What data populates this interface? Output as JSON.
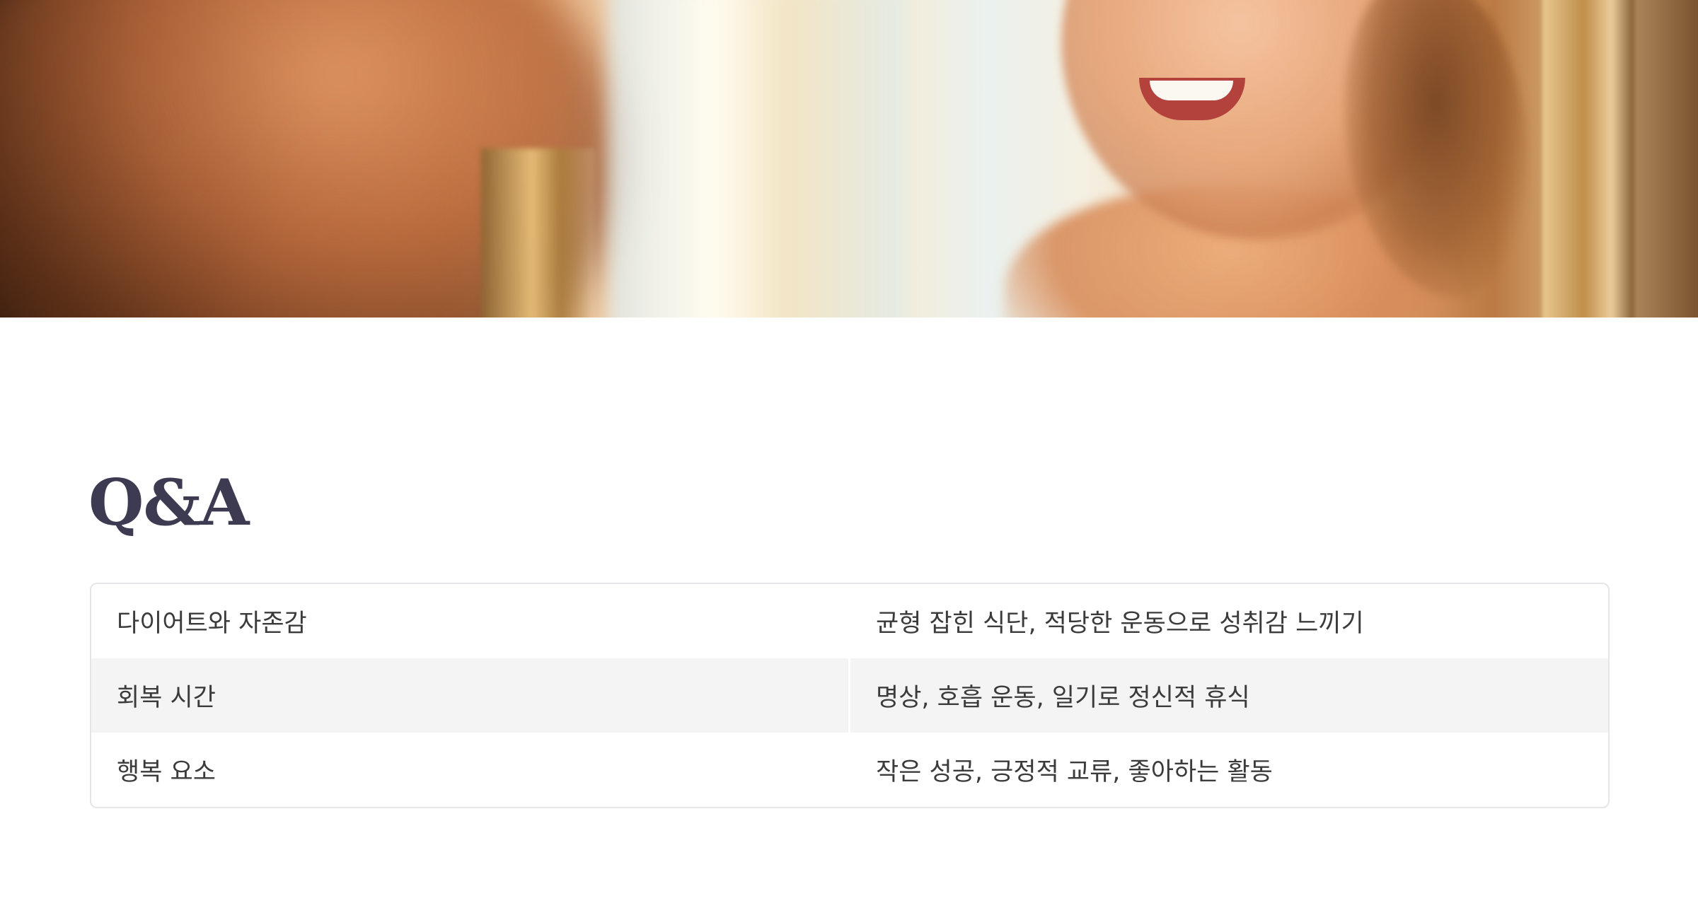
{
  "section": {
    "title": "Q&A"
  },
  "qa_rows": [
    {
      "question": "다이어트와 자존감",
      "answer": "균형 잡힌 식단, 적당한 운동으로 성취감 느끼기"
    },
    {
      "question": "회복 시간",
      "answer": "명상, 호흡 운동, 일기로 정신적 휴식"
    },
    {
      "question": "행복 요소",
      "answer": "작은 성공, 긍정적 교류, 좋아하는 활동"
    }
  ]
}
